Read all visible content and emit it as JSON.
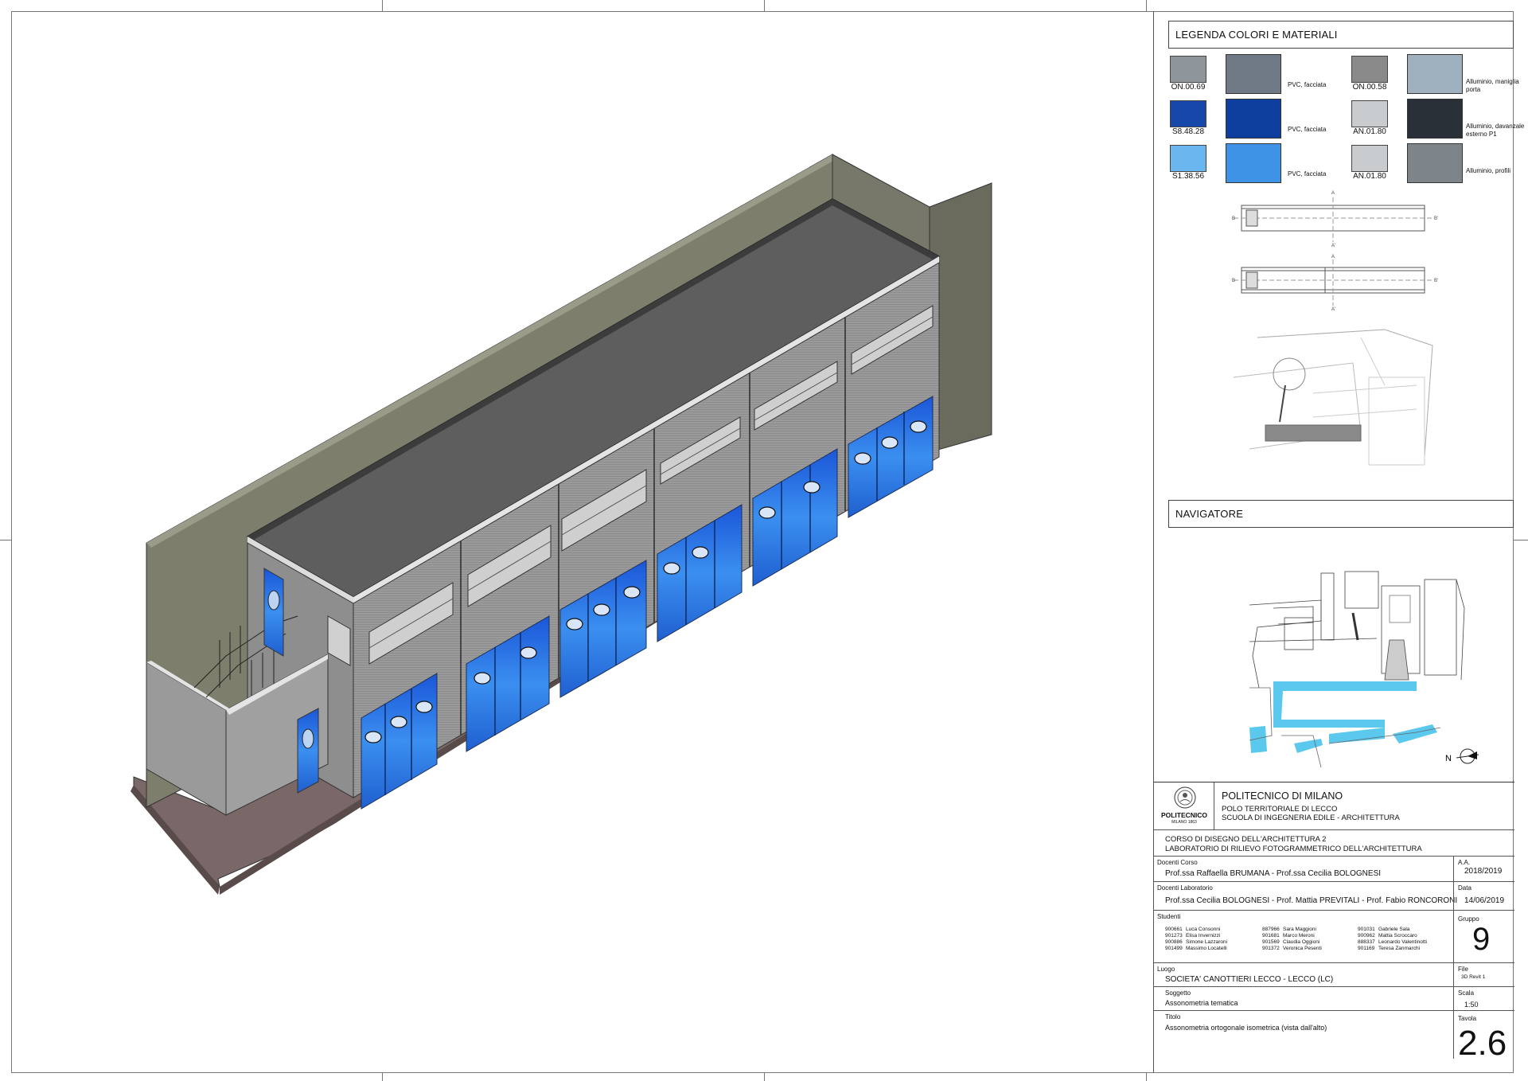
{
  "legend": {
    "title": "LEGENDA COLORI E MATERIALI",
    "rows": [
      {
        "code1": "ON.00.69",
        "color1": "#8e959b",
        "mat1_label": "PVC, facciata",
        "mat1_color": "#6f7a86",
        "code2": "ON.00.58",
        "color2": "#8a8a8a",
        "mat2_label": "Alluminio, maniglia porta",
        "mat2_color": "#9fb1bf"
      },
      {
        "code1": "S8.48.28",
        "color1": "#1548a8",
        "mat1_label": "PVC, facciata",
        "mat1_color": "#0f3f9e",
        "code2": "AN.01.80",
        "color2": "#c9ccce",
        "mat2_label": "Alluminio, davanzale esterno P1",
        "mat2_color": "#2a3038"
      },
      {
        "code1": "S1.38.56",
        "color1": "#6ab6ee",
        "mat1_label": "PVC, facciata",
        "mat1_color": "#3f93e6",
        "code2": "AN.01.80",
        "color2": "#c9ccce",
        "mat2_label": "Alluminio, profili",
        "mat2_color": "#7d848a"
      }
    ]
  },
  "plan_labels": {
    "a_top": "A",
    "b_left": "B",
    "b_right": "B'",
    "a_mid": "A'",
    "a_mid2": "A",
    "a_bottom": "A'"
  },
  "navigator": {
    "title": "NAVIGATORE",
    "north": "N"
  },
  "title_block": {
    "institution": "POLITECNICO DI MILANO",
    "logo_name": "POLITECNICO",
    "logo_sub": "MILANO 1863",
    "polo": "POLO TERRITORIALE DI LECCO",
    "school": "SCUOLA DI INGEGNERIA EDILE - ARCHITETTURA",
    "course1": "CORSO DI DISEGNO DELL'ARCHITETTURA 2",
    "course2": "LABORATORIO DI RILIEVO FOTOGRAMMETRICO DELL'ARCHITETTURA",
    "docenti_corso_label": "Docenti Corso",
    "docenti_corso": "Prof.ssa Raffaella BRUMANA - Prof.ssa Cecilia BOLOGNESI",
    "aa_label": "A.A.",
    "aa": "2018/2019",
    "docenti_lab_label": "Docenti Laboratorio",
    "docenti_lab": "Prof.ssa Cecilia BOLOGNESI - Prof. Mattia PREVITALI  - Prof. Fabio RONCORONI",
    "data_label": "Data",
    "data": "14/06/2019",
    "studenti_label": "Studenti",
    "students_col1": [
      {
        "id": "900661",
        "name": "Luca Consonni"
      },
      {
        "id": "901273",
        "name": "Elisa Invernizzi"
      },
      {
        "id": "900886",
        "name": "Simone Lazzaroni"
      },
      {
        "id": "901499",
        "name": "Massimo Locatelli"
      }
    ],
    "students_col2": [
      {
        "id": "887966",
        "name": "Sara Maggioni"
      },
      {
        "id": "901681",
        "name": "Marco Meroni"
      },
      {
        "id": "901569",
        "name": "Claudia Oggioni"
      },
      {
        "id": "901372",
        "name": "Veronica Pesenti"
      }
    ],
    "students_col3": [
      {
        "id": "901031",
        "name": "Gabriele Sala"
      },
      {
        "id": "900962",
        "name": "Mattia Scroccaro"
      },
      {
        "id": "888337",
        "name": "Leonardo Valentinotti"
      },
      {
        "id": "901169",
        "name": "Teresa Zanmarchi"
      }
    ],
    "gruppo_label": "Gruppo",
    "gruppo": "9",
    "luogo_label": "Luogo",
    "luogo": "SOCIETA' CANOTTIERI LECCO - LECCO (LC)",
    "file_label": "File",
    "file": "3D Revit 1",
    "soggetto_label": "Soggetto",
    "soggetto": "Assonometria tematica",
    "scala_label": "Scala",
    "scala": "1:50",
    "titolo_label": "Titolo",
    "titolo": "Assonometria ortogonale isometrica (vista dall'alto)",
    "tavola_label": "Tavola",
    "tavola": "2.6"
  }
}
